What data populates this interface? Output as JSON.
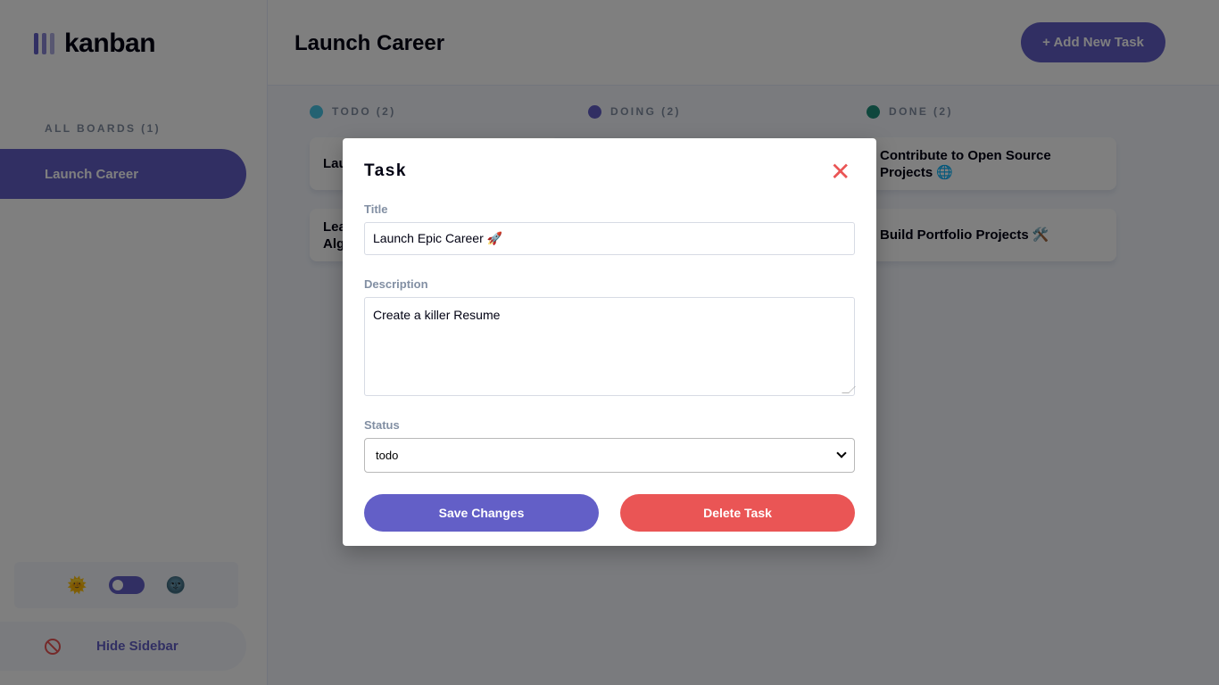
{
  "sidebar": {
    "logo_text": "kanban",
    "boards_heading": "ALL BOARDS (1)",
    "boards": [
      {
        "label": "Launch Career"
      }
    ],
    "theme_light_icon": "🌞",
    "theme_dark_icon": "🌚",
    "hide_label": "Hide Sidebar"
  },
  "header": {
    "board_title": "Launch Career",
    "add_task_label": "+ Add New Task"
  },
  "columns": [
    {
      "label": "TODO (2)",
      "color": "#49c4e5",
      "cards": [
        "Launch Epic Career 🚀",
        "Learn Data Structures and Algorithms 📚"
      ]
    },
    {
      "label": "DOING (2)",
      "color": "#635fc7",
      "cards": [
        "",
        ""
      ]
    },
    {
      "label": "DONE (2)",
      "color": "#1e8e7a",
      "cards": [
        "Contribute to Open Source Projects 🌐",
        "Build Portfolio Projects 🛠️"
      ]
    }
  ],
  "visible_card_text": {
    "todo_0": "Lau",
    "todo_1_line1": "Lea",
    "todo_1_line2": "Alg"
  },
  "modal": {
    "heading": "Task",
    "close_icon": "✕",
    "title_label": "Title",
    "title_value": "Launch Epic Career 🚀",
    "description_label": "Description",
    "description_value": "Create a killer Resume",
    "status_label": "Status",
    "status_value": "todo",
    "save_label": "Save Changes",
    "delete_label": "Delete Task"
  },
  "colors": {
    "accent": "#635fc7",
    "danger": "#ea5555"
  }
}
